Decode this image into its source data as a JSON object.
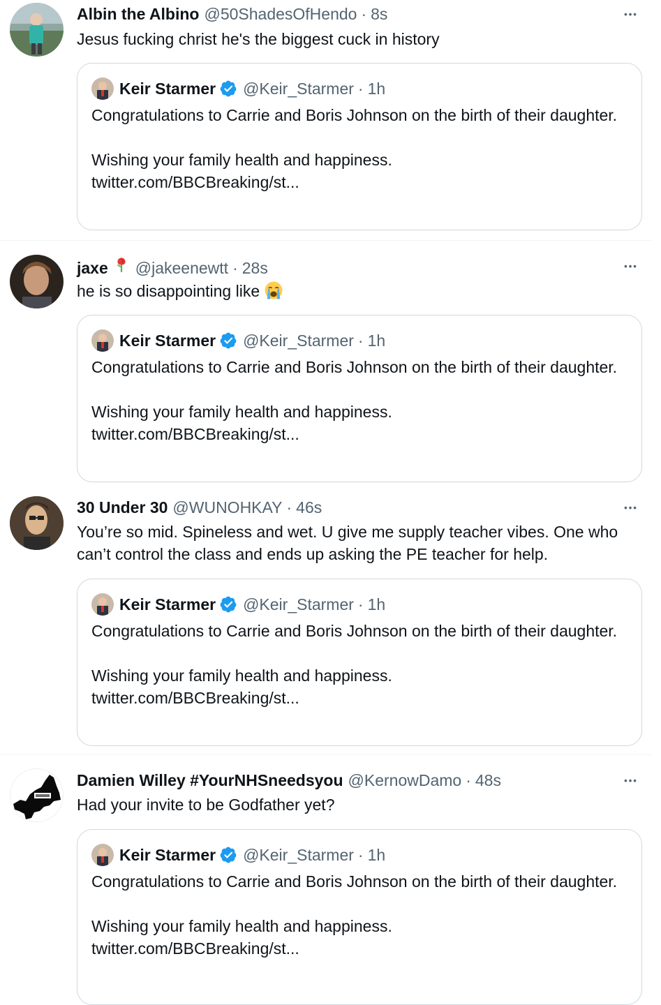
{
  "colors": {
    "text_primary": "#0f1419",
    "text_secondary": "#536471",
    "border": "#cfd9de",
    "verified_blue": "#1d9bf0"
  },
  "quoted_tweet": {
    "name": "Keir Starmer",
    "handle": "@Keir_Starmer",
    "time": "1h",
    "line1": "Congratulations to Carrie and Boris Johnson on the birth of their daughter.",
    "line2": "Wishing your family health and happiness.",
    "link": "twitter.com/BBCBreaking/st..."
  },
  "tweets": [
    {
      "name": "Albin the Albino",
      "handle": "@50ShadesOfHendo",
      "time": "8s",
      "text": "Jesus fucking christ he's the biggest cuck in history"
    },
    {
      "name": "jaxe",
      "name_icon": "rose-icon",
      "handle": "@jakeenewtt",
      "time": "28s",
      "text": "he is so disappointing like",
      "text_emoji": "loudly-crying-face-emoji"
    },
    {
      "name": "30 Under 30",
      "handle": "@WUNOHKAY",
      "time": "46s",
      "text": "You’re so mid. Spineless and wet. U give me supply teacher vibes. One who can’t control the class and ends up asking the PE teacher for help."
    },
    {
      "name": "Damien Willey #YourNHSneedsyou",
      "handle": "@KernowDamo",
      "time": "48s",
      "text": "Had your invite to be Godfather yet?"
    }
  ],
  "separator": "·",
  "more_label": "•••"
}
